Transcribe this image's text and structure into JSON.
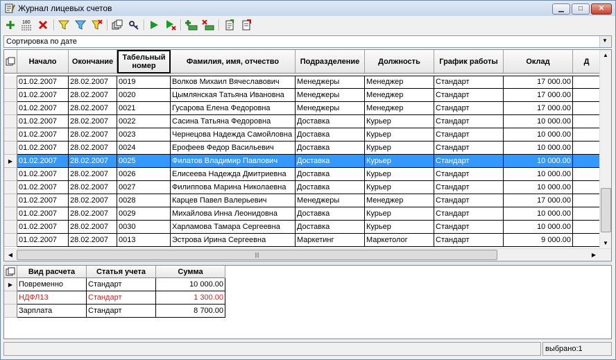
{
  "window": {
    "title": "Журнал лицевых счетов",
    "icon": "journal-book-icon"
  },
  "toolbar": {
    "buttons": [
      {
        "name": "add-button",
        "icon": "plus-icon"
      },
      {
        "name": "sort-button",
        "icon": "sort-180-icon",
        "label": "180"
      },
      {
        "name": "delete-button",
        "icon": "red-x-icon"
      },
      {
        "name": "filter-button",
        "icon": "funnel-icon"
      },
      {
        "name": "filter-select-button",
        "icon": "funnel-select-icon"
      },
      {
        "name": "filter-clear-button",
        "icon": "funnel-clear-icon"
      },
      {
        "name": "copy-records-button",
        "icon": "stack-copy-icon"
      },
      {
        "name": "link-button",
        "icon": "key-link-icon"
      },
      {
        "name": "run-button",
        "icon": "play-icon"
      },
      {
        "name": "run-step-button",
        "icon": "play-step-icon"
      },
      {
        "name": "add-account-button",
        "icon": "green-plus-cash-icon"
      },
      {
        "name": "delete-account-button",
        "icon": "red-x-cash-icon"
      },
      {
        "name": "document-button",
        "icon": "document-arrow-icon"
      },
      {
        "name": "document-edit-button",
        "icon": "document-edit-icon"
      }
    ]
  },
  "sort": {
    "value": "Сортировка по дате"
  },
  "main_grid": {
    "columns": [
      "Начало",
      "Окончание",
      "Табельный номер",
      "Фамилия, имя, отчество",
      "Подразделение",
      "Должность",
      "График работы",
      "Оклад",
      "Д"
    ],
    "selected_index": 6,
    "rows": [
      [
        "01.02.2007",
        "28.02.2007",
        "0019",
        "Волков Михаил Вячеславович",
        "Менеджеры",
        "Менеджер",
        "Стандарт",
        "17 000.00"
      ],
      [
        "01.02.2007",
        "28.02.2007",
        "0020",
        "Цымлянская Татьяна Ивановна",
        "Менеджеры",
        "Менеджер",
        "Стандарт",
        "17 000.00"
      ],
      [
        "01.02.2007",
        "28.02.2007",
        "0021",
        "Гусарова Елена Федоровна",
        "Менеджеры",
        "Менеджер",
        "Стандарт",
        "17 000.00"
      ],
      [
        "01.02.2007",
        "28.02.2007",
        "0022",
        "Сасина Татьяна Федоровна",
        "Доставка",
        "Курьер",
        "Стандарт",
        "10 000.00"
      ],
      [
        "01.02.2007",
        "28.02.2007",
        "0023",
        "Чернецова Надежда Самойловна",
        "Доставка",
        "Курьер",
        "Стандарт",
        "10 000.00"
      ],
      [
        "01.02.2007",
        "28.02.2007",
        "0024",
        "Ерофеев Федор Васильевич",
        "Доставка",
        "Курьер",
        "Стандарт",
        "10 000.00"
      ],
      [
        "01.02.2007",
        "28.02.2007",
        "0025",
        "Филатов Владимир Павлович",
        "Доставка",
        "Курьер",
        "Стандарт",
        "10 000.00"
      ],
      [
        "01.02.2007",
        "28.02.2007",
        "0026",
        "Елисеева Надежда Дмитриевна",
        "Доставка",
        "Курьер",
        "Стандарт",
        "10 000.00"
      ],
      [
        "01.02.2007",
        "28.02.2007",
        "0027",
        "Филиппова Марина Николаевна",
        "Доставка",
        "Курьер",
        "Стандарт",
        "10 000.00"
      ],
      [
        "01.02.2007",
        "28.02.2007",
        "0028",
        "Карцев Павел Валерьевич",
        "Менеджеры",
        "Менеджер",
        "Стандарт",
        "17 000.00"
      ],
      [
        "01.02.2007",
        "28.02.2007",
        "0029",
        "Михайлова Инна Леонидовна",
        "Доставка",
        "Курьер",
        "Стандарт",
        "10 000.00"
      ],
      [
        "01.02.2007",
        "28.02.2007",
        "0030",
        "Харламова Тамара Сергеевна",
        "Доставка",
        "Курьер",
        "Стандарт",
        "10 000.00"
      ],
      [
        "01.02.2007",
        "28.02.2007",
        "0013",
        "Эстрова Ирина Сергеевна",
        "Маркетинг",
        "Маркетолог",
        "Стандарт",
        "9 000.00"
      ]
    ]
  },
  "detail_grid": {
    "columns": [
      "Вид расчета",
      "Статья учета",
      "Сумма"
    ],
    "selected_index": 0,
    "rows": [
      {
        "cells": [
          "Повременно",
          "Стандарт",
          "10 000.00"
        ],
        "color": "#000000"
      },
      {
        "cells": [
          "НДФЛ13",
          "Стандарт",
          "1 300.00"
        ],
        "color": "#e01b1b"
      },
      {
        "cells": [
          "Зарплата",
          "Стандарт",
          "8 700.00"
        ],
        "color": "#000000"
      }
    ]
  },
  "status": {
    "left": "",
    "selected": "выбрано:1"
  },
  "colors": {
    "selection": "#3399ff",
    "negative": "#e01b1b"
  }
}
